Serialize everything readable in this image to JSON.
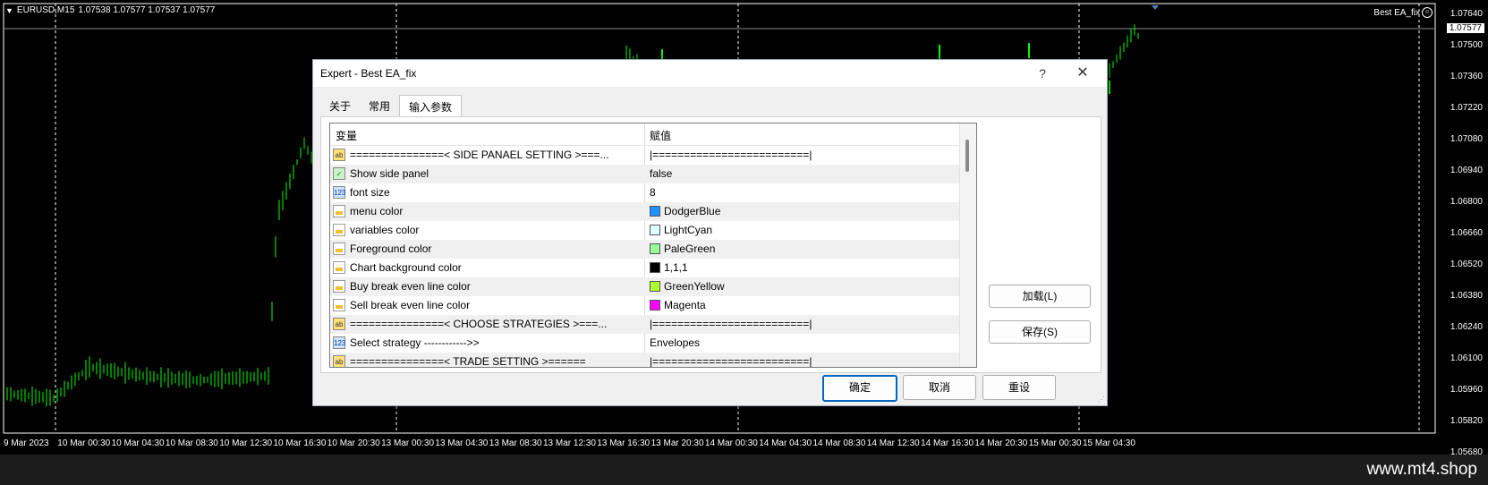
{
  "chart": {
    "symbol": "EURUSD,M15",
    "ohlc": "1.07538 1.07577 1.07537 1.07577",
    "ea_name": "Best EA_fix",
    "current_price": "1.07577",
    "price_levels": [
      "1.07640",
      "1.07500",
      "1.07360",
      "1.07220",
      "1.07080",
      "1.06940",
      "1.06800",
      "1.06660",
      "1.06520",
      "1.06380",
      "1.06240",
      "1.06100",
      "1.05960",
      "1.05820",
      "1.05680"
    ],
    "time_labels": [
      "9 Mar 2023",
      "10 Mar 00:30",
      "10 Mar 04:30",
      "10 Mar 08:30",
      "10 Mar 12:30",
      "10 Mar 16:30",
      "10 Mar 20:30",
      "13 Mar 00:30",
      "13 Mar 04:30",
      "13 Mar 08:30",
      "13 Mar 12:30",
      "13 Mar 16:30",
      "13 Mar 20:30",
      "14 Mar 00:30",
      "14 Mar 04:30",
      "14 Mar 08:30",
      "14 Mar 12:30",
      "14 Mar 16:30",
      "14 Mar 20:30",
      "15 Mar 00:30",
      "15 Mar 04:30"
    ],
    "colors": {
      "background": "#000000",
      "candles": "#00ff00",
      "grid": "#ffffff"
    }
  },
  "dialog": {
    "title": "Expert - Best EA_fix",
    "help": "?",
    "close": "✕",
    "tabs": [
      {
        "label": "关于",
        "active": false
      },
      {
        "label": "常用",
        "active": false
      },
      {
        "label": "输入参数",
        "active": true
      }
    ],
    "grid": {
      "col_variable": "变量",
      "col_value": "赋值",
      "rows": [
        {
          "icon": "ab",
          "name": "===============< SIDE PANAEL SETTING >===...",
          "value": "|=========================|"
        },
        {
          "icon": "bool",
          "name": "Show side panel",
          "value": "false"
        },
        {
          "icon": "num",
          "name": "font size",
          "value": "8"
        },
        {
          "icon": "clr",
          "name": "menu color",
          "value": "DodgerBlue",
          "swatch": "#1e90ff"
        },
        {
          "icon": "clr",
          "name": "variables color",
          "value": "LightCyan",
          "swatch": "#e0ffff"
        },
        {
          "icon": "clr",
          "name": "Foreground color",
          "value": "PaleGreen",
          "swatch": "#98fb98"
        },
        {
          "icon": "clr",
          "name": "Chart background color",
          "value": "1,1,1",
          "swatch": "#010101"
        },
        {
          "icon": "clr",
          "name": "Buy break even line color",
          "value": "GreenYellow",
          "swatch": "#adff2f"
        },
        {
          "icon": "clr",
          "name": "Sell break even line color",
          "value": "Magenta",
          "swatch": "#ff00ff"
        },
        {
          "icon": "ab",
          "name": "===============< CHOOSE STRATEGIES >===...",
          "value": "|=========================|"
        },
        {
          "icon": "num",
          "name": "Select strategy ------------>>",
          "value": "Envelopes"
        },
        {
          "icon": "ab",
          "name": "===============< TRADE SETTING >======",
          "value": "|=========================|"
        }
      ]
    },
    "load_button": "加载(L)",
    "save_button": "保存(S)",
    "ok_button": "确定",
    "cancel_button": "取消",
    "reset_button": "重设"
  },
  "watermark": "www.mt4.shop"
}
